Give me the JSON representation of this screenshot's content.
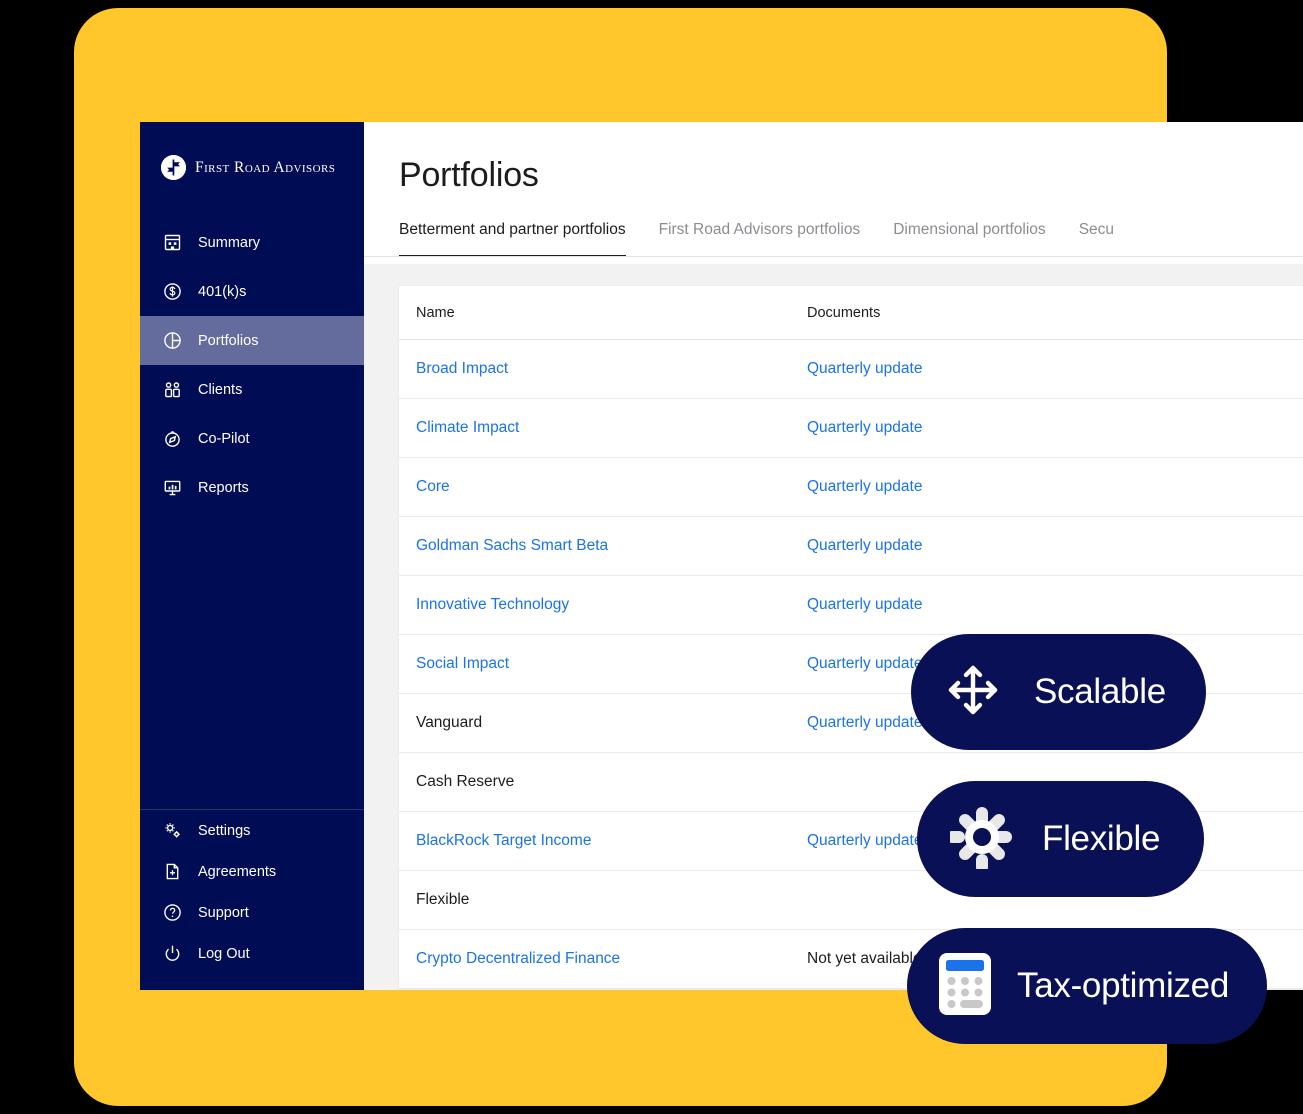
{
  "theme": {
    "yellow": "#FFC72C",
    "navy": "#000D54",
    "pill_navy": "#0A1055",
    "active_nav": "#646C9E",
    "link_blue": "#1A73E8",
    "panel_grey": "#F2F2F2",
    "text_dark": "#1C1C1C",
    "tab_inactive": "#8A8D91"
  },
  "sidebar": {
    "brand": {
      "name": "First Road Advisors",
      "icon": "signpost-logo-icon"
    },
    "primary_items": [
      {
        "label": "Summary",
        "icon": "building-icon",
        "active": false
      },
      {
        "label": "401(k)s",
        "icon": "dollar-circle-icon",
        "active": false
      },
      {
        "label": "Portfolios",
        "icon": "pie-chart-icon",
        "active": true
      },
      {
        "label": "Clients",
        "icon": "people-icon",
        "active": false
      },
      {
        "label": "Co-Pilot",
        "icon": "compass-icon",
        "active": false
      },
      {
        "label": "Reports",
        "icon": "presentation-chart-icon",
        "active": false
      }
    ],
    "secondary_items": [
      {
        "label": "Settings",
        "icon": "gears-icon"
      },
      {
        "label": "Agreements",
        "icon": "document-plus-icon"
      },
      {
        "label": "Support",
        "icon": "question-circle-icon"
      },
      {
        "label": "Log Out",
        "icon": "power-icon"
      }
    ]
  },
  "header": {
    "title": "Portfolios",
    "tabs": [
      {
        "label": "Betterment and partner portfolios",
        "active": true
      },
      {
        "label": "First Road Advisors portfolios",
        "active": false
      },
      {
        "label": "Dimensional portfolios",
        "active": false
      },
      {
        "label": "Secu",
        "active": false
      }
    ]
  },
  "table": {
    "columns": [
      "Name",
      "Documents"
    ],
    "rows": [
      {
        "name": "Broad Impact",
        "name_link": true,
        "documents": "Quarterly update",
        "documents_link": true
      },
      {
        "name": "Climate Impact",
        "name_link": true,
        "documents": "Quarterly update",
        "documents_link": true
      },
      {
        "name": "Core",
        "name_link": true,
        "documents": "Quarterly update",
        "documents_link": true
      },
      {
        "name": "Goldman Sachs Smart Beta",
        "name_link": true,
        "documents": "Quarterly update",
        "documents_link": true
      },
      {
        "name": "Innovative Technology",
        "name_link": true,
        "documents": "Quarterly update",
        "documents_link": true
      },
      {
        "name": "Social Impact",
        "name_link": true,
        "documents": "Quarterly update",
        "documents_link": true
      },
      {
        "name": "Vanguard",
        "name_link": false,
        "documents": "Quarterly update",
        "documents_link": true
      },
      {
        "name": "Cash Reserve",
        "name_link": false,
        "documents": "",
        "documents_link": false
      },
      {
        "name": "BlackRock Target Income",
        "name_link": true,
        "documents": "Quarterly update",
        "documents_link": true
      },
      {
        "name": "Flexible",
        "name_link": false,
        "documents": "",
        "documents_link": false
      },
      {
        "name": "Crypto Decentralized Finance",
        "name_link": true,
        "documents": "Not yet available",
        "documents_link": false
      }
    ]
  },
  "pills": [
    {
      "label": "Scalable",
      "icon": "four-way-arrows-icon"
    },
    {
      "label": "Flexible",
      "icon": "gear-icon"
    },
    {
      "label": "Tax-optimized",
      "icon": "calculator-icon"
    }
  ]
}
